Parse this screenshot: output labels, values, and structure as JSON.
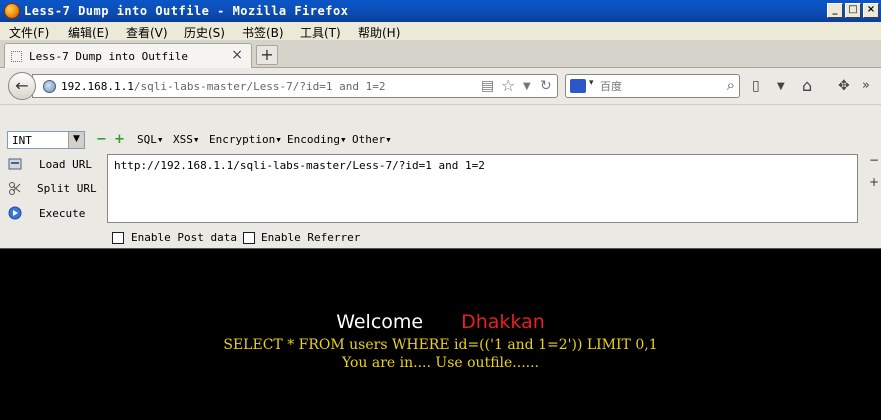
{
  "window": {
    "title": "Less-7 Dump into Outfile - Mozilla Firefox",
    "minimize": "_",
    "maximize": "□",
    "close": "×"
  },
  "menu": [
    "文件(F)",
    "编辑(E)",
    "查看(V)",
    "历史(S)",
    "书签(B)",
    "工具(T)",
    "帮助(H)"
  ],
  "tab": {
    "label": "Less-7 Dump into Outfile",
    "close": "×",
    "new": "+"
  },
  "nav": {
    "back": "←",
    "url_host": "192.168.1.1",
    "url_path": "/sqli-labs-master/Less-7/?id=1 and 1=2",
    "search_placeholder": "百度",
    "icons": [
      "rss-icon",
      "bookmark-star-icon",
      "dropdown-icon",
      "reload-icon",
      "search-icon",
      "bookmarks-icon",
      "home-icon",
      "addon-icon"
    ]
  },
  "hackbar": {
    "select_value": "INT",
    "menus": [
      "SQL▾",
      "XSS▾",
      "Encryption▾",
      "Encoding▾",
      "Other▾"
    ],
    "load_url": "Load URL",
    "split_url": "Split URL",
    "execute": "Execute",
    "textarea_value": "http://192.168.1.1/sqli-labs-master/Less-7/?id=1 and 1=2",
    "enable_post": "Enable Post data",
    "enable_referrer": "Enable Referrer"
  },
  "page": {
    "welcome": "Welcome",
    "name": "Dhakkan",
    "sql": "SELECT * FROM users WHERE id=(('1 and 1=2')) LIMIT 0,1",
    "message": "You are in.... Use outfile......"
  },
  "colors": {
    "titlebar": "#0c4fb8",
    "content_bg": "#000000",
    "name_red": "#e42020",
    "text_yellow": "#ebd21e"
  }
}
